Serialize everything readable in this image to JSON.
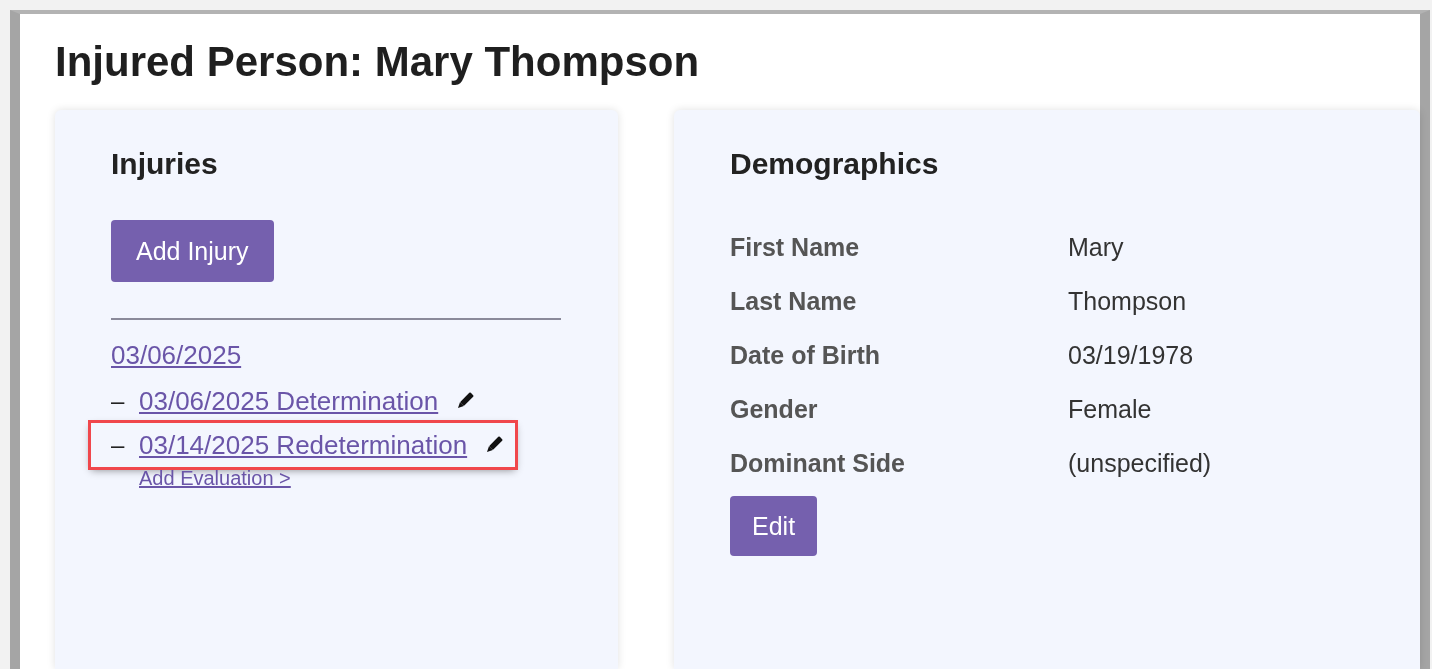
{
  "page_title": "Injured Person: Mary Thompson",
  "injuries": {
    "heading": "Injuries",
    "add_button": "Add Injury",
    "items": [
      {
        "date": "03/06/2025",
        "evaluations": [
          {
            "bullet": "–",
            "label": "03/06/2025 Determination",
            "highlighted": false
          },
          {
            "bullet": "–",
            "label": "03/14/2025 Redetermination",
            "highlighted": true
          }
        ],
        "add_evaluation": "Add Evaluation >"
      }
    ]
  },
  "demographics": {
    "heading": "Demographics",
    "fields": [
      {
        "label": "First Name",
        "value": "Mary"
      },
      {
        "label": "Last Name",
        "value": "Thompson"
      },
      {
        "label": "Date of Birth",
        "value": "03/19/1978"
      },
      {
        "label": "Gender",
        "value": "Female"
      },
      {
        "label": "Dominant Side",
        "value": "(unspecified)"
      }
    ],
    "edit_button": "Edit"
  }
}
